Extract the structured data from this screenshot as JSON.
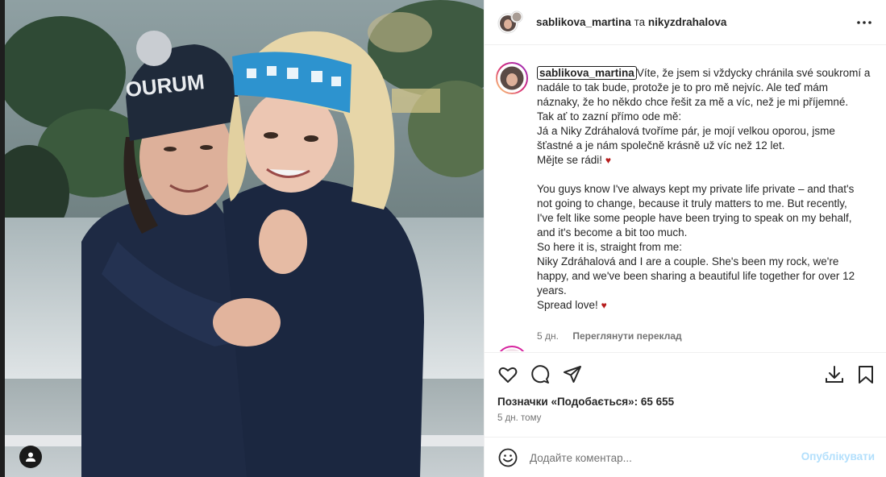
{
  "colors": {
    "accent": "#0095f6",
    "publish_disabled": "#b2dffc",
    "heart": "#b71c1c",
    "muted_text": "#737373",
    "story_ring": "#d6249f"
  },
  "photo": {
    "hat_text": "OURUM"
  },
  "header": {
    "author": "sablikova_martina",
    "joiner": "та",
    "coauthor": "nikyzdrahalova",
    "more_icon": "more-horizontal-icon"
  },
  "caption": {
    "username": "sablikova_martina",
    "lines": [
      "Víte, že jsem si vždycky chránila své soukromí a",
      "nadále to tak bude, protože je to pro mě nejvíc. Ale teď mám",
      "náznaky, že ho někdo chce řešit za mě a víc, než je mi příjemné.",
      "Tak ať to zazní přímo ode mě:",
      "Já a Niky Zdráhalová tvoříme pár, je mojí velkou oporou, jsme",
      "šťastné a je nám společně krásně už víc než 12 let.",
      "Mějte se rádi!",
      "You guys know I've always kept my private life private – and that's",
      "not going to change, because it truly matters to me. But recently,",
      "I've felt like some people have been trying to speak on my behalf,",
      "and it's become a bit too much.",
      "So here it is, straight from me:",
      "Niky Zdráhalová and I are a couple. She's been my rock, we're",
      "happy, and we've been sharing a beautiful life together for over 12",
      "years.",
      "Spread love!"
    ],
    "heart": "♥",
    "age": "5 дн.",
    "translate_label": "Переглянути переклад"
  },
  "actions": {
    "like_icon": "heart-icon",
    "comment_icon": "comment-icon",
    "share_icon": "share-icon",
    "download_icon": "download-icon",
    "save_icon": "bookmark-icon"
  },
  "likes_text": "Позначки «Подобається»: 65 655",
  "posted_text": "5 дн. тому",
  "comment_bar": {
    "placeholder": "Додайте коментар...",
    "publish_label": "Опублікувати"
  }
}
